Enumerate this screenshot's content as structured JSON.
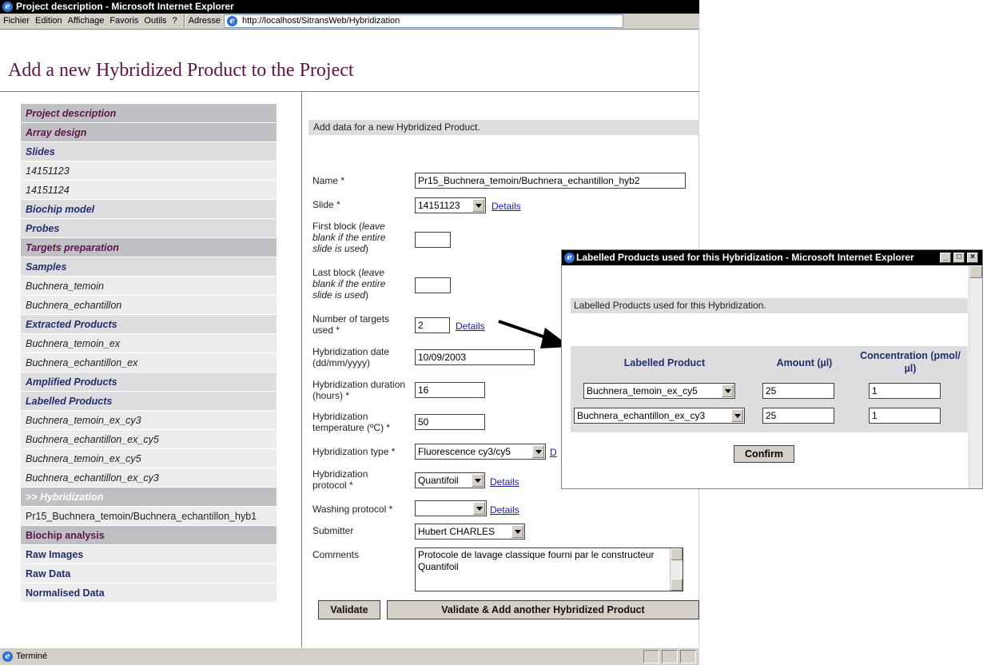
{
  "window": {
    "title": "Project description - Microsoft Internet Explorer",
    "menu": [
      "Fichier",
      "Edition",
      "Affichage",
      "Favoris",
      "Outils",
      "?"
    ],
    "address_label": "Adresse",
    "address": "http://localhost/SitransWeb/Hybridization",
    "status": "Terminé"
  },
  "page": {
    "title": "Add a new Hybridized Product to the Project"
  },
  "sidebar": {
    "items": [
      "Project description",
      "Array design",
      "Slides",
      "14151123",
      "14151124",
      "Biochip model",
      "Probes",
      "Targets preparation",
      "Samples",
      "Buchnera_temoin",
      "Buchnera_echantillon",
      "Extracted Products",
      "Buchnera_temoin_ex",
      "Buchnera_echantillon_ex",
      "Amplified Products",
      "Labelled Products",
      "Buchnera_temoin_ex_cy3",
      "Buchnera_echantillon_ex_cy5",
      "Buchnera_temoin_ex_cy5",
      "Buchnera_echantillon_ex_cy3",
      ">> Hybridization",
      "Pr15_Buchnera_temoin/Buchnera_echantillon_hyb1",
      "Biochip analysis",
      "Raw Images",
      "Raw Data",
      "Normalised Data"
    ]
  },
  "form": {
    "intro": "Add data for a new Hybridized Product.",
    "name_label": "Name *",
    "name_value": "Pr15_Buchnera_temoin/Buchnera_echantillon_hyb2",
    "slide_label": "Slide *",
    "slide_value": "14151123",
    "first_block_label": "First block (",
    "first_block_hint": "leave blank if the entire slide is used",
    "first_block_close": ")",
    "last_block_label": "Last block (",
    "last_block_hint": "leave blank if the entire slide is used",
    "last_block_close": ")",
    "num_targets_label": "Number of targets used *",
    "num_targets_value": "2",
    "date_label": "Hybridization date (dd/mm/yyyy)",
    "date_value": "10/09/2003",
    "duration_label": "Hybridization duration (hours) *",
    "duration_value": "16",
    "temperature_label": "Hybridization temperature (ºC) *",
    "temperature_value": "50",
    "type_label": "Hybridization type *",
    "type_value": "Fluorescence cy3/cy5",
    "type_link_partial": "D",
    "protocol_label": "Hybridization protocol *",
    "protocol_value": "Quantifoil",
    "washing_label": "Washing protocol *",
    "washing_value": "",
    "submitter_label": "Submitter",
    "submitter_value": "Hubert CHARLES",
    "comments_label": "Comments",
    "comments_value": "Protocole de lavage classique fourni par le constructeur Quantifoil",
    "details_link": "Details",
    "validate_button": "Validate",
    "validate_add_button": "Validate & Add another Hybridized Product"
  },
  "popup": {
    "title": "Labelled Products used for this Hybridization - Microsoft Internet Explorer",
    "intro": "Labelled Products used for this Hybridization.",
    "col_product": "Labelled Product",
    "col_amount": "Amount (µl)",
    "col_concentration": "Concentration (pmol/µl)",
    "rows": [
      {
        "product": "Buchnera_temoin_ex_cy5",
        "amount": "25",
        "concentration": "1"
      },
      {
        "product": "Buchnera_echantillon_ex_cy3",
        "amount": "25",
        "concentration": "1"
      }
    ],
    "confirm_button": "Confirm"
  }
}
